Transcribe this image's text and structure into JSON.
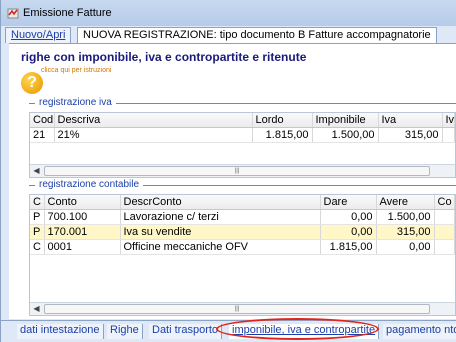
{
  "window": {
    "title": "Emissione Fatture"
  },
  "top_tabs": [
    {
      "label": "Nuovo/Apri"
    },
    {
      "label": "NUOVA REGISTRAZIONE: tipo documento B Fatture accompagnatorie"
    }
  ],
  "panel": {
    "heading": "righe con imponibile, iva e contropartite e ritenute",
    "help_text": "clicca qui per istruzioni"
  },
  "iva": {
    "legend": "registrazione iva",
    "columns": [
      "Cod",
      "Descriva",
      "Lordo",
      "Imponibile",
      "Iva",
      "Iv"
    ],
    "rows": [
      {
        "cod": "21",
        "descr": "21%",
        "lordo": "1.815,00",
        "imponibile": "1.500,00",
        "iva": "315,00"
      }
    ]
  },
  "contabile": {
    "legend": "registrazione contabile",
    "columns": [
      "C",
      "Conto",
      "DescrConto",
      "Dare",
      "Avere",
      "Co"
    ],
    "rows": [
      {
        "c": "P",
        "conto": "700.100",
        "descr": "Lavorazione c/ terzi",
        "dare": "0,00",
        "avere": "1.500,00"
      },
      {
        "c": "P",
        "conto": "170.001",
        "descr": "Iva su vendite",
        "dare": "0,00",
        "avere": "315,00"
      },
      {
        "c": "C",
        "conto": "0001",
        "descr": "Officine meccaniche OFV",
        "dare": "1.815,00",
        "avere": "0,00"
      }
    ]
  },
  "bottom_tabs": [
    {
      "label": "dati intestazione"
    },
    {
      "label": "Righe"
    },
    {
      "label": "Dati trasporto"
    },
    {
      "label": "imponibile, iva e contropartite"
    },
    {
      "label": "pagamento nto e"
    }
  ],
  "colors": {
    "highlight_ellipse": "#e0241c",
    "heading": "#1a1a7a",
    "legend": "#1a3fa8"
  }
}
